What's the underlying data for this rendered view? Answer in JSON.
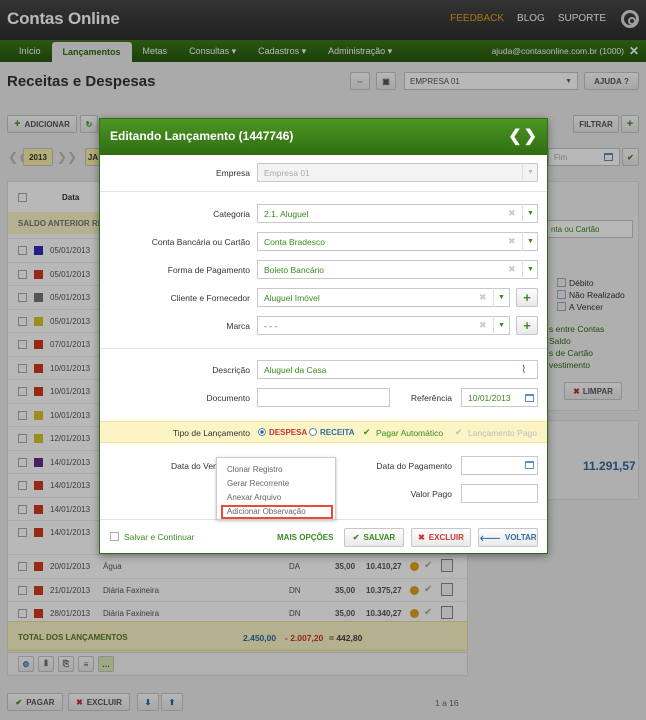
{
  "app": {
    "title": "Contas Online",
    "links": [
      "FEEDBACK",
      "BLOG",
      "SUPORTE"
    ]
  },
  "nav": {
    "items": [
      "Início",
      "Lançamentos",
      "Metas",
      "Consultas ▾",
      "Cadastros ▾",
      "Administração ▾"
    ],
    "user": "ajuda@contasonline.com.br (1000)"
  },
  "page": {
    "title": "Receitas e Despesas",
    "empresa": "EMPRESA 01",
    "ajuda": "AJUDA"
  },
  "toolbar": {
    "adicionar": "ADICIONAR",
    "filtrar": "FILTRAR",
    "year": "2013",
    "ja": "JA",
    "fim": "Fim"
  },
  "list": {
    "col_data": "Data",
    "saldo_label": "SALDO ANTERIOR REA",
    "rows": [
      {
        "date": "05/01/2013",
        "color": "#2b2bb8"
      },
      {
        "date": "05/01/2013",
        "color": "#d13a1e"
      },
      {
        "date": "05/01/2013",
        "color": "#777777"
      },
      {
        "date": "05/01/2013",
        "color": "#d8c52a"
      },
      {
        "date": "07/01/2013",
        "color": "#d13a1e"
      },
      {
        "date": "10/01/2013",
        "color": "#d13a1e"
      },
      {
        "date": "10/01/2013",
        "color": "#d13a1e"
      },
      {
        "date": "10/01/2013",
        "color": "#d8c52a"
      },
      {
        "date": "12/01/2013",
        "color": "#d8c52a"
      },
      {
        "date": "14/01/2013",
        "color": "#6a2a8a"
      },
      {
        "date": "14/01/2013",
        "color": "#d13a1e"
      },
      {
        "date": "14/01/2013",
        "color": "#d13a1e"
      },
      {
        "date": "14/01/2013",
        "color": "#d13a1e"
      }
    ],
    "bottom_rows": [
      {
        "date": "20/01/2013",
        "desc": "Água",
        "code": "DA",
        "val": "35,00",
        "saldo": "10.410,27",
        "color": "#d13a1e"
      },
      {
        "date": "21/01/2013",
        "desc": "Diária Faxineira",
        "code": "DN",
        "val": "35,00",
        "saldo": "10.375,27",
        "color": "#d13a1e"
      },
      {
        "date": "28/01/2013",
        "desc": "Diária Faxineira",
        "code": "DN",
        "val": "35,00",
        "saldo": "10.340,27",
        "color": "#d13a1e"
      }
    ],
    "total_label": "TOTAL DOS LANÇAMENTOS",
    "total_rec": "2.450,00",
    "total_desp": "- 2.007,20",
    "total_saldo": "= 442,80",
    "pagar": "PAGAR",
    "excluir": "EXCLUIR",
    "pages": "1 a 16"
  },
  "right": {
    "cartao": "nta ou Cartão",
    "debito": "Débito",
    "nao_realizado": "Não Realizado",
    "a_vencer": "A Vencer",
    "lines": [
      "s entre Contas",
      "Saldo",
      "s de Cartão",
      "vestimento"
    ],
    "limpar": "LIMPAR",
    "saldo": "11.291,57"
  },
  "modal": {
    "title": "Editando Lançamento (1447746)",
    "empresa_label": "Empresa",
    "empresa_val": "Empresa 01",
    "categoria_label": "Categoria",
    "categoria_val": "2.1. Aluguel",
    "conta_label": "Conta Bancária ou Cartão",
    "conta_val": "Conta Bradesco",
    "forma_label": "Forma de Pagamento",
    "forma_val": "Boleto Bancário",
    "cliente_label": "Cliente e Fornecedor",
    "cliente_val": "Aluguel Imóvel",
    "marca_label": "Marca",
    "marca_val": "- - -",
    "descricao_label": "Descrição",
    "descricao_val": "Aluguel da Casa",
    "documento_label": "Documento",
    "referencia_label": "Referência",
    "referencia_val": "10/01/2013",
    "tipo_label": "Tipo de Lançamento",
    "despesa": "DESPESA",
    "receita": "RECEITA",
    "pagar_auto": "Pagar Automático",
    "lanc_pago": "Lançamento Pago",
    "venc_label": "Data do Ven",
    "data_pag_label": "Data do Pagamento",
    "valor_pago_label": "Valor Pago",
    "salvar_continuar": "Salvar e Continuar",
    "mais_opcoes": "MAIS OPÇÕES",
    "salvar": "SALVAR",
    "excluir": "EXCLUIR",
    "voltar": "VOLTAR",
    "menu": [
      "Clonar Registro",
      "Gerar Recorrente",
      "Anexar Arquivo",
      "Adicionar Observação"
    ]
  }
}
